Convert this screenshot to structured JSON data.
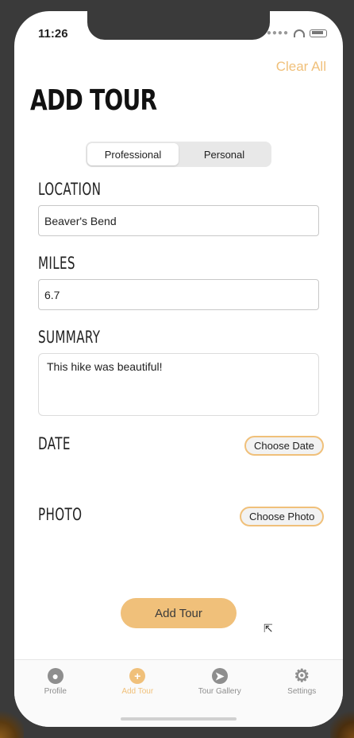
{
  "status_bar": {
    "time": "11:26"
  },
  "header": {
    "clear_all_label": "Clear All",
    "title": "ADD TOUR"
  },
  "segmented_control": {
    "options": [
      "Professional",
      "Personal"
    ],
    "selected": "Professional"
  },
  "form": {
    "location": {
      "label": "LOCATION",
      "value": "Beaver's Bend"
    },
    "miles": {
      "label": "MILES",
      "value": "6.7"
    },
    "summary": {
      "label": "SUMMARY",
      "value": "This hike was beautiful!"
    },
    "date": {
      "label": "DATE",
      "button_label": "Choose Date"
    },
    "photo": {
      "label": "PHOTO",
      "button_label": "Choose Photo"
    }
  },
  "add_tour_button_label": "Add Tour",
  "tab_bar": {
    "items": [
      {
        "label": "Profile",
        "icon": "person-icon"
      },
      {
        "label": "Add Tour",
        "icon": "plus-icon",
        "active": true
      },
      {
        "label": "Tour Gallery",
        "icon": "compass-icon"
      },
      {
        "label": "Settings",
        "icon": "gear-icon"
      }
    ]
  },
  "colors": {
    "accent": "#f0c07a",
    "inactive": "#8e8e8e"
  }
}
